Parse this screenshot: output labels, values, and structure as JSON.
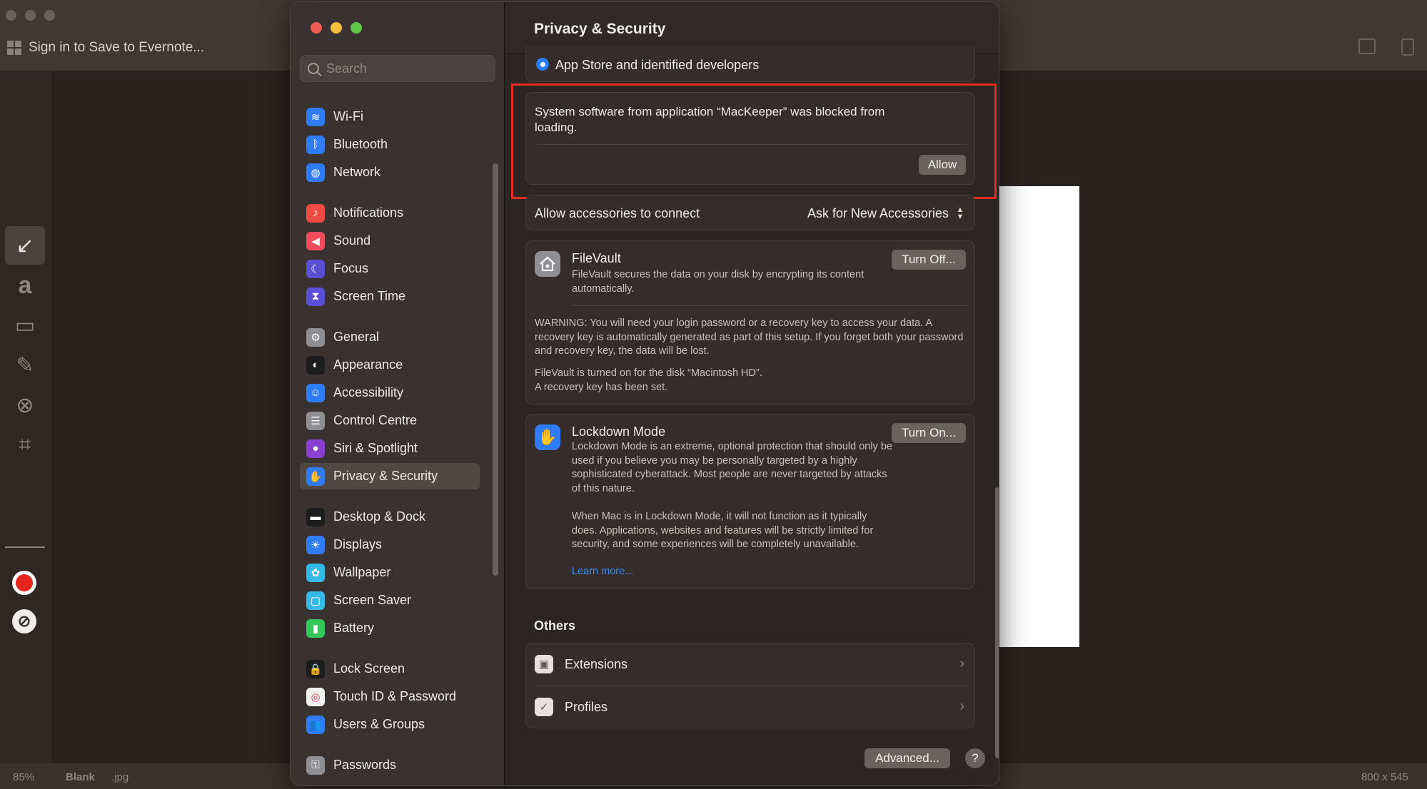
{
  "background_app": {
    "signin_label": "Sign in to Save to Evernote...",
    "status": {
      "zoom": "85%",
      "name": "Blank",
      "ext": ".jpg",
      "size": "800 x 545"
    }
  },
  "window": {
    "title": "Privacy & Security",
    "search": {
      "placeholder": "Search",
      "value": ""
    }
  },
  "sidebar": {
    "items": [
      {
        "label": "Wi-Fi",
        "icon": "wifi-icon",
        "color": "#2f7cf6"
      },
      {
        "label": "Bluetooth",
        "icon": "bluetooth-icon",
        "color": "#2f7cf6"
      },
      {
        "label": "Network",
        "icon": "globe-icon",
        "color": "#2f7cf6"
      },
      {
        "label": "Notifications",
        "icon": "bell-icon",
        "color": "#ee4b44"
      },
      {
        "label": "Sound",
        "icon": "speaker-icon",
        "color": "#ee4b5d"
      },
      {
        "label": "Focus",
        "icon": "moon-icon",
        "color": "#5b4fd6"
      },
      {
        "label": "Screen Time",
        "icon": "hourglass-icon",
        "color": "#5b4fd6"
      },
      {
        "label": "General",
        "icon": "gear-icon",
        "color": "#8e8e93"
      },
      {
        "label": "Appearance",
        "icon": "appearance-icon",
        "color": "#1c1c1e"
      },
      {
        "label": "Accessibility",
        "icon": "accessibility-icon",
        "color": "#2f7cf6"
      },
      {
        "label": "Control Centre",
        "icon": "toggles-icon",
        "color": "#8e8e93"
      },
      {
        "label": "Siri & Spotlight",
        "icon": "siri-icon",
        "color": "#8a3fd0"
      },
      {
        "label": "Privacy & Security",
        "icon": "hand-icon",
        "color": "#2f7cf6",
        "selected": true
      },
      {
        "label": "Desktop & Dock",
        "icon": "dock-icon",
        "color": "#1c1c1e"
      },
      {
        "label": "Displays",
        "icon": "sun-icon",
        "color": "#2f7cf6"
      },
      {
        "label": "Wallpaper",
        "icon": "flower-icon",
        "color": "#35b9e6"
      },
      {
        "label": "Screen Saver",
        "icon": "screensaver-icon",
        "color": "#35b9e6"
      },
      {
        "label": "Battery",
        "icon": "battery-icon",
        "color": "#34c759"
      },
      {
        "label": "Lock Screen",
        "icon": "lock-icon",
        "color": "#1c1c1e"
      },
      {
        "label": "Touch ID & Password",
        "icon": "fingerprint-icon",
        "color": "#f2f2f2"
      },
      {
        "label": "Users & Groups",
        "icon": "users-icon",
        "color": "#2f7cf6"
      },
      {
        "label": "Passwords",
        "icon": "key-icon",
        "color": "#8e8e93"
      }
    ]
  },
  "content": {
    "appstore_option": "App Store and identified developers",
    "blocked": {
      "message": "System software from application “MacKeeper” was blocked from loading.",
      "allow_label": "Allow"
    },
    "accessories": {
      "label": "Allow accessories to connect",
      "value": "Ask for New Accessories"
    },
    "filevault": {
      "title": "FileVault",
      "desc": "FileVault secures the data on your disk by encrypting its content automatically.",
      "button": "Turn Off...",
      "warning": "WARNING: You will need your login password or a recovery key to access your data. A recovery key is automatically generated as part of this setup. If you forget both your password and recovery key, the data will be lost.",
      "status_line1": "FileVault is turned on for the disk “Macintosh HD”.",
      "status_line2": "A recovery key has been set."
    },
    "lockdown": {
      "title": "Lockdown Mode",
      "desc1": "Lockdown Mode is an extreme, optional protection that should only be used if you believe you may be personally targeted by a highly sophisticated cyberattack. Most people are never targeted by attacks of this nature.",
      "desc2": "When Mac is in Lockdown Mode, it will not function as it typically does. Applications, websites and features will be strictly limited for security, and some experiences will be completely unavailable.",
      "learn_more": "Learn more...",
      "button": "Turn On..."
    },
    "others": {
      "title": "Others",
      "items": [
        {
          "label": "Extensions",
          "icon": "extensions-icon"
        },
        {
          "label": "Profiles",
          "icon": "profiles-icon"
        }
      ]
    },
    "advanced_label": "Advanced...",
    "help_label": "?"
  },
  "colors": {
    "accent": "#2a7cf6",
    "highlight": "#e32b22"
  }
}
